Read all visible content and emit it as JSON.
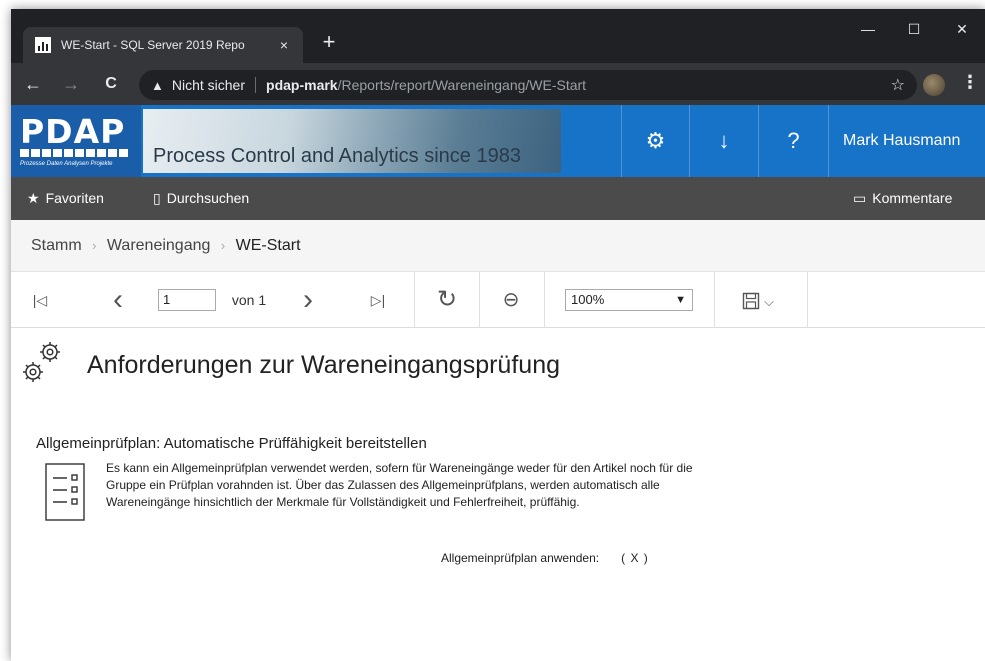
{
  "browser": {
    "tab_title": "WE-Start - SQL Server 2019 Repo",
    "tab_close": "×",
    "new_tab": "+",
    "window_controls": [
      "—",
      "☐",
      "✕"
    ],
    "nav": {
      "back": "←",
      "forward": "→",
      "reload": "C"
    },
    "security_label": "Nicht sicher",
    "url_host": "pdap-mark",
    "url_path": "/Reports/report/Wareneingang/WE-Start",
    "bookmark": "☆",
    "menu": "⋮"
  },
  "header": {
    "logo_text": "PDAP",
    "logo_tagline": "Prozesse Daten Analysen Projekte",
    "banner_text": "Process Control and Analytics since 1983",
    "settings_icon": "⚙",
    "download_icon": "↓",
    "help_icon": "?",
    "user_name": "Mark Hausmann"
  },
  "menubar": {
    "favorites": "Favoriten",
    "browse": "Durchsuchen",
    "comments": "Kommentare"
  },
  "breadcrumb": {
    "items": [
      "Stamm",
      "Wareneingang",
      "WE-Start"
    ],
    "separator": "›"
  },
  "report_toolbar": {
    "first_page": "|◁",
    "prev_page": "‹",
    "current_page": "1",
    "page_of": "von 1",
    "next_page": "›",
    "last_page": "▷|",
    "refresh": "↻",
    "back": "⊖",
    "zoom": "100%",
    "save_chevron": "⌵"
  },
  "report": {
    "title": "Anforderungen zur Wareneingangsprüfung",
    "section_title": "Allgemeinprüfplan: Automatische Prüffähigkeit bereitstellen",
    "paragraph": "Es kann ein Allgemeinprüfplan verwendet werden, sofern für Wareneingänge weder für den Artikel noch für die Gruppe ein Prüfplan vorahnden ist. Über das Zulassen des Allgemeinprüfplans, werden automatisch alle Wareneingänge hinsichtlich der Merkmale für Vollständigkeit und Fehlerfreiheit, prüffähig.",
    "apply_label": "Allgemeinprüfplan anwenden:",
    "apply_value": "( X )"
  },
  "colors": {
    "header_blue": "#1673c8",
    "menubar_gray": "#4b4b4b",
    "chrome_dark": "#202124"
  }
}
